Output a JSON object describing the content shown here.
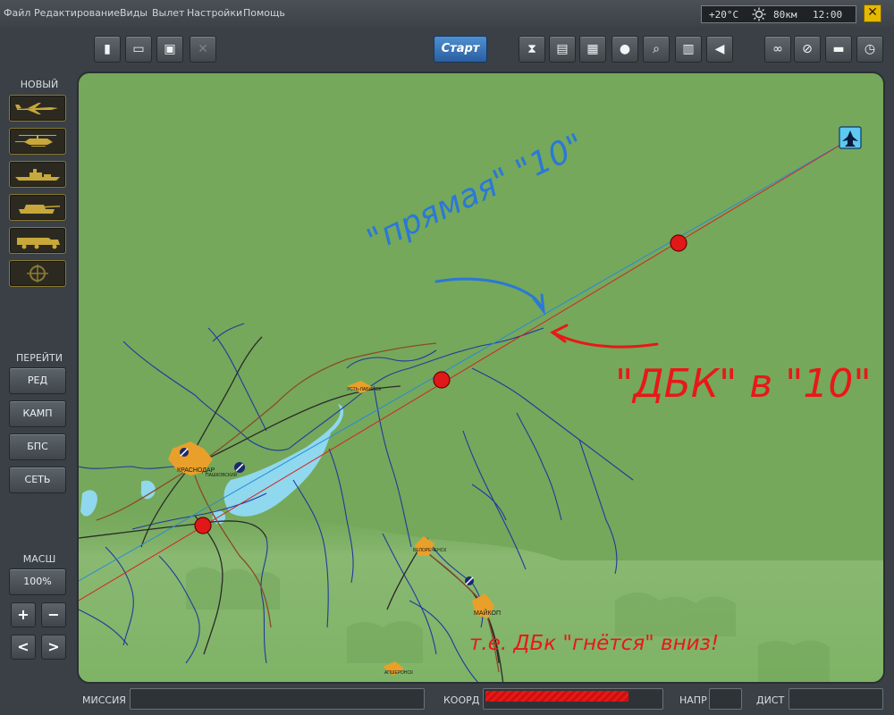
{
  "menu": [
    "Файл",
    "Редактирование",
    "Виды",
    "Вылет",
    "Настройки",
    "Помощь"
  ],
  "weather": {
    "temp": "+20°C",
    "wind": "80км",
    "time": "12:00"
  },
  "toolbar": {
    "start_label": "Старт",
    "file_buttons": [
      "new-mission-icon",
      "open-folder-icon",
      "save-icon",
      "disabled-x-icon"
    ],
    "view_buttons": [
      "hourglass-icon",
      "sd-card-icon",
      "clipboard-icon",
      "head-profile-icon",
      "magnifier-icon",
      "book-icon",
      "speaker-icon"
    ],
    "right_buttons": [
      "binoculars-icon",
      "no-entry-icon",
      "ship-icon",
      "clock-icon"
    ]
  },
  "left_panel": {
    "new_label": "НОВЫЙ",
    "unit_buttons": [
      "plane-icon",
      "helicopter-icon",
      "ship-icon",
      "tank-icon",
      "fuel-truck-icon",
      "static-target-icon"
    ],
    "goto_label": "ПЕРЕЙТИ",
    "goto_buttons": [
      "РЕД",
      "КАМП",
      "БПС",
      "СЕТЬ"
    ],
    "zoom_label": "МАСШ",
    "zoom_value": "100%",
    "zoom_in": "+",
    "zoom_out": "−",
    "pan_left": "<",
    "pan_right": ">"
  },
  "map": {
    "cities": [
      "КРАСНОДАР",
      "ПАШКОВСКИЙ",
      "УСТЬ-ЛАБИНСК",
      "БЕЛОРЕЧЕНСК",
      "МАЙКОП",
      "АПШЕРОНСК"
    ],
    "annotations": {
      "blue_text": "\"прямая\" \"10\"",
      "red_text": "\"ДБК\" в \"10\"",
      "red_bottom": "т.е. ДБк \"гнётся\" вниз!"
    }
  },
  "status": {
    "mission_label": "МИССИЯ",
    "coord_label": "КООРД",
    "dir_label": "НАПР",
    "dist_label": "ДИСТ",
    "mission_value": "",
    "dir_value": "",
    "dist_value": ""
  },
  "colors": {
    "map_green": "#75a85a",
    "water": "#8fd8ee",
    "river": "#1f3a9e",
    "city": "#e8a02a",
    "waypoint": "#e01818",
    "annotation_blue": "#2a78d8",
    "annotation_red": "#e81818"
  }
}
